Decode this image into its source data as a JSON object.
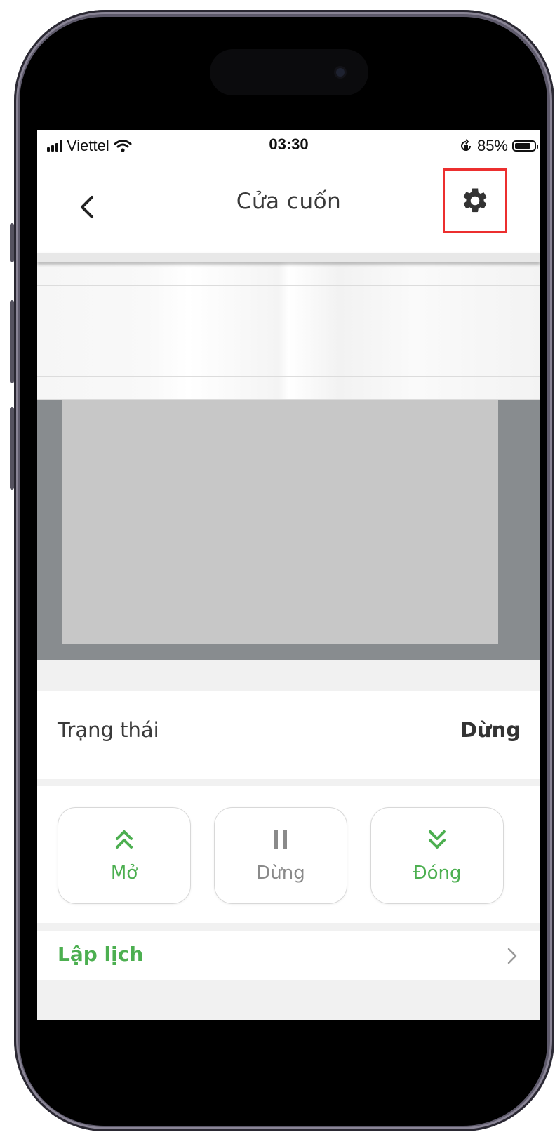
{
  "status_bar": {
    "carrier": "Viettel",
    "time": "03:30",
    "battery": "85%",
    "battery_level": 0.85
  },
  "nav": {
    "title": "Cửa cuốn",
    "back_icon": "chevron-left-icon",
    "settings_icon": "gear-icon",
    "highlight_color": "#ec2f2f"
  },
  "door": {
    "slat_count": 6,
    "frame_color": "#888c8f",
    "opening_color": "#c7c7c7"
  },
  "status": {
    "label": "Trạng thái",
    "value": "Dừng"
  },
  "actions": [
    {
      "label": "Mở",
      "icon": "double-chevron-up-icon",
      "color": "#4caf50"
    },
    {
      "label": "Dừng",
      "icon": "pause-icon",
      "color": "#8a8a8a"
    },
    {
      "label": "Đóng",
      "icon": "double-chevron-down-icon",
      "color": "#4caf50"
    }
  ],
  "schedule": {
    "label": "Lập lịch",
    "icon": "chevron-right-icon"
  },
  "accent_color": "#4caf50"
}
